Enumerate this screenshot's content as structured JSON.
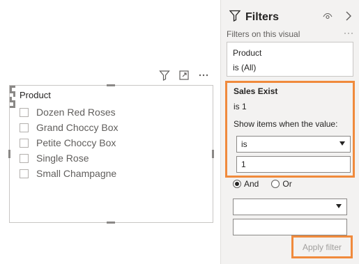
{
  "visual": {
    "slicer_title": "Product",
    "items": [
      {
        "label": "Dozen Red Roses"
      },
      {
        "label": "Grand Choccy Box"
      },
      {
        "label": "Petite Choccy Box"
      },
      {
        "label": "Single Rose"
      },
      {
        "label": "Small Champagne"
      }
    ],
    "header_icons": [
      "filter-icon",
      "focus-mode-icon",
      "more-options-icon"
    ]
  },
  "filters_pane": {
    "title": "Filters",
    "section_label": "Filters on this visual",
    "more_icon": "···",
    "product_card": {
      "name": "Product",
      "state": "is (All)"
    },
    "sales_card": {
      "name": "Sales Exist",
      "state": "is 1",
      "help_text": "Show items when the value:",
      "operator1": "is",
      "value1": "1",
      "logic_options": [
        {
          "label": "And",
          "selected": true
        },
        {
          "label": "Or",
          "selected": false
        }
      ],
      "operator2": "",
      "value2": ""
    },
    "apply_button": "Apply filter"
  },
  "colors": {
    "highlight": "#f08a3c",
    "pane_bg": "#f3f2f1"
  }
}
